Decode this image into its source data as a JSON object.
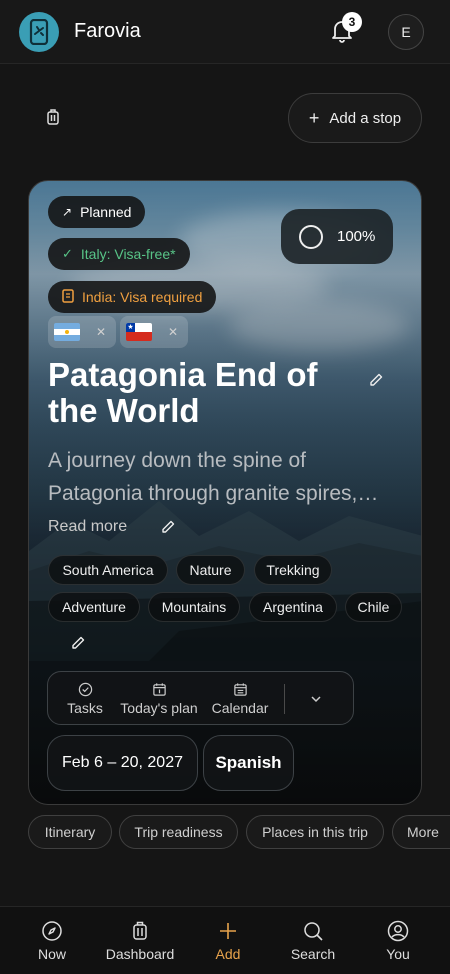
{
  "app": {
    "name": "Farovia"
  },
  "header": {
    "notification_count": "3",
    "avatar_initial": "E",
    "logo_icon": "phone-plane-icon",
    "bell_icon": "bell-icon"
  },
  "toolbar": {
    "add_stop_label": "Add a stop",
    "add_icon": "plus-icon",
    "luggage_icon": "luggage-icon"
  },
  "trip": {
    "status": "Planned",
    "visas": [
      {
        "label": "Italy: Visa-free*",
        "color": "#58c487"
      },
      {
        "label": "India: Visa required",
        "color": "#f0a040"
      }
    ],
    "readiness_label": "100%",
    "readiness_value": 1.0,
    "flags": [
      {
        "country_icon": "argentina-flag-icon"
      },
      {
        "country_icon": "chile-flag-icon"
      }
    ],
    "title": "Patagonia End of the World",
    "description": "A journey down the spine of Patagonia through granite spires, glacial lakes and windswept steppe.",
    "read_more_label": "Read more",
    "tags": [
      "South America",
      "Nature",
      "Trekking",
      "Adventure",
      "Mountains",
      "Argentina",
      "Chile"
    ],
    "actions": [
      {
        "label": "Tasks",
        "icon": "check-circle-icon"
      },
      {
        "label": "Today's plan",
        "icon": "calendar-day-icon"
      },
      {
        "label": "Calendar",
        "icon": "calendar-icon"
      }
    ],
    "dates": "Feb 6 – 20, 2027",
    "language": "Spanish"
  },
  "section_tabs": [
    "Itinerary",
    "Trip readiness",
    "Places in this trip",
    "More"
  ],
  "bottom_nav": [
    {
      "label": "Now",
      "icon": "compass-icon"
    },
    {
      "label": "Dashboard",
      "icon": "luggage-icon"
    },
    {
      "label": "Add",
      "icon": "plus-icon",
      "color": "#e8a34c"
    },
    {
      "label": "Search",
      "icon": "search-icon"
    },
    {
      "label": "You",
      "icon": "user-circle-icon"
    }
  ]
}
